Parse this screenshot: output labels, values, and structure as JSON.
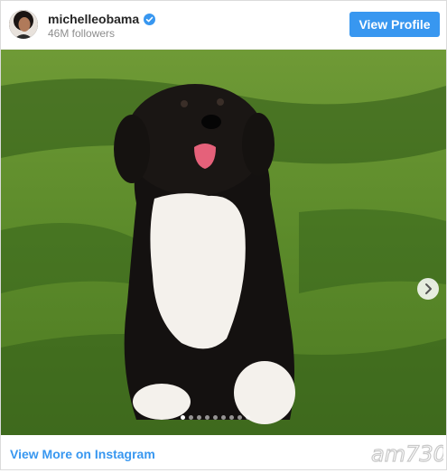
{
  "header": {
    "username": "michelleobama",
    "followers": "46M followers",
    "view_profile_label": "View Profile"
  },
  "media": {
    "description_icon": "photo",
    "carousel_count": 9,
    "carousel_active_index": 0
  },
  "footer": {
    "view_more_label": "View More on Instagram"
  },
  "watermark": {
    "text": "am730"
  },
  "colors": {
    "accent": "#3897f0",
    "verified": "#3897f0",
    "grass": "#5c8a2c"
  }
}
